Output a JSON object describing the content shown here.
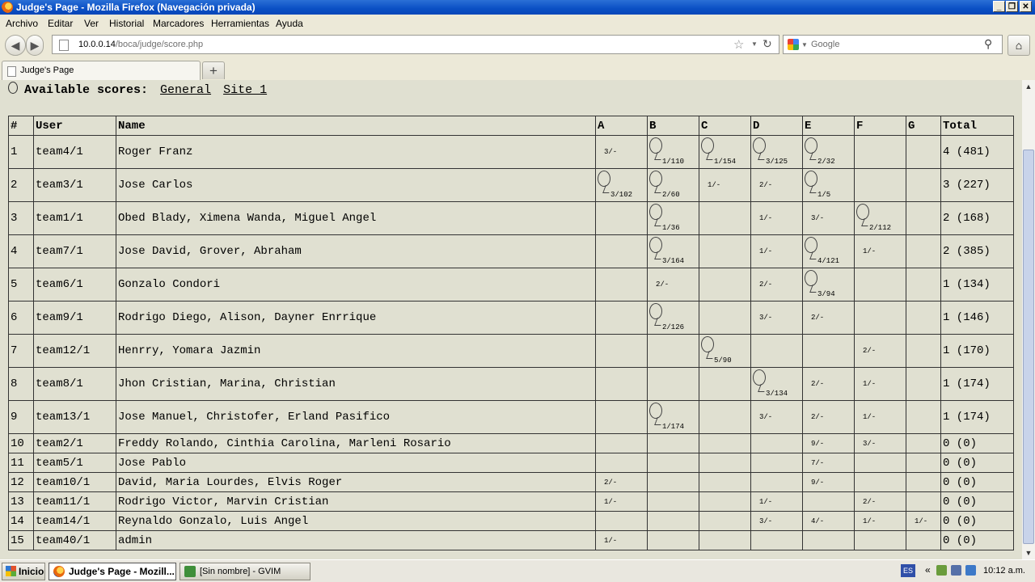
{
  "window": {
    "title": "Judge's Page - Mozilla Firefox (Navegación privada)"
  },
  "menu": [
    "Archivo",
    "Editar",
    "Ver",
    "Historial",
    "Marcadores",
    "Herramientas",
    "Ayuda"
  ],
  "nav": {
    "url_host": "10.0.0.14",
    "url_path": "/boca/judge/score.php",
    "search_placeholder": "Google"
  },
  "tab": {
    "label": "Judge's Page",
    "new_tab": "+"
  },
  "scores": {
    "heading": "Available scores:",
    "links": [
      "General",
      "Site 1"
    ]
  },
  "table": {
    "headers": [
      "#",
      "User",
      "Name",
      "A",
      "B",
      "C",
      "D",
      "E",
      "F",
      "G",
      "Total"
    ],
    "rows": [
      {
        "rank": "1",
        "user": "team4/1",
        "name": "Roger Franz",
        "cells": [
          [
            "3/-",
            false
          ],
          [
            "1/110",
            true
          ],
          [
            "1/154",
            true
          ],
          [
            "3/125",
            true
          ],
          [
            "2/32",
            true
          ],
          [
            "",
            false
          ],
          [
            "",
            false
          ]
        ],
        "total": "4 (481)",
        "big": true
      },
      {
        "rank": "2",
        "user": "team3/1",
        "name": "Jose Carlos",
        "cells": [
          [
            "3/102",
            true
          ],
          [
            "2/60",
            true
          ],
          [
            "1/-",
            false
          ],
          [
            "2/-",
            false
          ],
          [
            "1/5",
            true
          ],
          [
            "",
            false
          ],
          [
            "",
            false
          ]
        ],
        "total": "3 (227)",
        "big": true
      },
      {
        "rank": "3",
        "user": "team1/1",
        "name": "Obed Blady, Ximena Wanda, Miguel Angel",
        "cells": [
          [
            "",
            false
          ],
          [
            "1/36",
            true
          ],
          [
            "",
            false
          ],
          [
            "1/-",
            false
          ],
          [
            "3/-",
            false
          ],
          [
            "2/112",
            true
          ],
          [
            "",
            false
          ]
        ],
        "total": "2 (168)",
        "big": true
      },
      {
        "rank": "4",
        "user": "team7/1",
        "name": "Jose David, Grover, Abraham",
        "cells": [
          [
            "",
            false
          ],
          [
            "3/164",
            true
          ],
          [
            "",
            false
          ],
          [
            "1/-",
            false
          ],
          [
            "4/121",
            true
          ],
          [
            "1/-",
            false
          ],
          [
            "",
            false
          ]
        ],
        "total": "2 (385)",
        "big": true
      },
      {
        "rank": "5",
        "user": "team6/1",
        "name": "Gonzalo Condori",
        "cells": [
          [
            "",
            false
          ],
          [
            "2/-",
            false
          ],
          [
            "",
            false
          ],
          [
            "2/-",
            false
          ],
          [
            "3/94",
            true
          ],
          [
            "",
            false
          ],
          [
            "",
            false
          ]
        ],
        "total": "1 (134)",
        "big": true
      },
      {
        "rank": "6",
        "user": "team9/1",
        "name": "Rodrigo Diego, Alison, Dayner Enrrique",
        "cells": [
          [
            "",
            false
          ],
          [
            "2/126",
            true
          ],
          [
            "",
            false
          ],
          [
            "3/-",
            false
          ],
          [
            "2/-",
            false
          ],
          [
            "",
            false
          ],
          [
            "",
            false
          ]
        ],
        "total": "1 (146)",
        "big": true
      },
      {
        "rank": "7",
        "user": "team12/1",
        "name": "Henrry, Yomara Jazmin",
        "cells": [
          [
            "",
            false
          ],
          [
            "",
            false
          ],
          [
            "5/90",
            true
          ],
          [
            "",
            false
          ],
          [
            "",
            false
          ],
          [
            "2/-",
            false
          ],
          [
            "",
            false
          ]
        ],
        "total": "1 (170)",
        "big": true
      },
      {
        "rank": "8",
        "user": "team8/1",
        "name": "Jhon Cristian, Marina, Christian",
        "cells": [
          [
            "",
            false
          ],
          [
            "",
            false
          ],
          [
            "",
            false
          ],
          [
            "3/134",
            true
          ],
          [
            "2/-",
            false
          ],
          [
            "1/-",
            false
          ],
          [
            "",
            false
          ]
        ],
        "total": "1 (174)",
        "big": true
      },
      {
        "rank": "9",
        "user": "team13/1",
        "name": "Jose Manuel, Christofer, Erland Pasifico",
        "cells": [
          [
            "",
            false
          ],
          [
            "1/174",
            true
          ],
          [
            "",
            false
          ],
          [
            "3/-",
            false
          ],
          [
            "2/-",
            false
          ],
          [
            "1/-",
            false
          ],
          [
            "",
            false
          ]
        ],
        "total": "1 (174)",
        "big": true
      },
      {
        "rank": "10",
        "user": "team2/1",
        "name": "Freddy Rolando, Cinthia Carolina, Marleni Rosario",
        "cells": [
          [
            "",
            false
          ],
          [
            "",
            false
          ],
          [
            "",
            false
          ],
          [
            "",
            false
          ],
          [
            "9/-",
            false
          ],
          [
            "3/-",
            false
          ],
          [
            "",
            false
          ]
        ],
        "total": "0 (0)",
        "big": false
      },
      {
        "rank": "11",
        "user": "team5/1",
        "name": "Jose Pablo",
        "cells": [
          [
            "",
            false
          ],
          [
            "",
            false
          ],
          [
            "",
            false
          ],
          [
            "",
            false
          ],
          [
            "7/-",
            false
          ],
          [
            "",
            false
          ],
          [
            "",
            false
          ]
        ],
        "total": "0 (0)",
        "big": false
      },
      {
        "rank": "12",
        "user": "team10/1",
        "name": "David, Maria Lourdes, Elvis Roger",
        "cells": [
          [
            "2/-",
            false
          ],
          [
            "",
            false
          ],
          [
            "",
            false
          ],
          [
            "",
            false
          ],
          [
            "9/-",
            false
          ],
          [
            "",
            false
          ],
          [
            "",
            false
          ]
        ],
        "total": "0 (0)",
        "big": false
      },
      {
        "rank": "13",
        "user": "team11/1",
        "name": "Rodrigo Victor, Marvin Cristian",
        "cells": [
          [
            "1/-",
            false
          ],
          [
            "",
            false
          ],
          [
            "",
            false
          ],
          [
            "1/-",
            false
          ],
          [
            "",
            false
          ],
          [
            "2/-",
            false
          ],
          [
            "",
            false
          ]
        ],
        "total": "0 (0)",
        "big": false
      },
      {
        "rank": "14",
        "user": "team14/1",
        "name": "Reynaldo Gonzalo, Luis Angel",
        "cells": [
          [
            "",
            false
          ],
          [
            "",
            false
          ],
          [
            "",
            false
          ],
          [
            "3/-",
            false
          ],
          [
            "4/-",
            false
          ],
          [
            "1/-",
            false
          ],
          [
            "1/-",
            false
          ]
        ],
        "total": "0 (0)",
        "big": false
      },
      {
        "rank": "15",
        "user": "team40/1",
        "name": "admin",
        "cells": [
          [
            "1/-",
            false
          ],
          [
            "",
            false
          ],
          [
            "",
            false
          ],
          [
            "",
            false
          ],
          [
            "",
            false
          ],
          [
            "",
            false
          ],
          [
            "",
            false
          ]
        ],
        "total": "0 (0)",
        "big": false
      }
    ]
  },
  "taskbar": {
    "start": "Inicio",
    "items": [
      "Judge's Page - Mozill...",
      "[Sin nombre] - GVIM"
    ],
    "lang": "ES",
    "clock": "10:12 a.m."
  },
  "colors": {
    "titlebar": "#0a4fc4",
    "content_bg": "#e0e0d1",
    "chrome_bg": "#ece9d8"
  }
}
